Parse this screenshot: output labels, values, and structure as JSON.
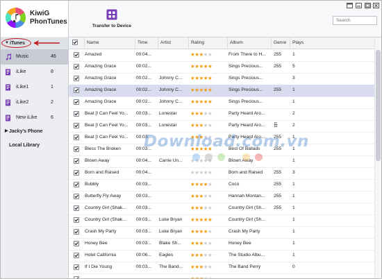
{
  "app": {
    "name_line1": "KiwiG",
    "name_line2": "PhonTunes"
  },
  "sidebar": {
    "itunes_label": "iTunes",
    "items": [
      {
        "label": "Music",
        "count": "46",
        "icon": "music-note-icon",
        "selected": true
      },
      {
        "label": "iLike",
        "count": "8",
        "icon": "playlist-icon"
      },
      {
        "label": "iLike1",
        "count": "1",
        "icon": "playlist-icon"
      },
      {
        "label": "iLike2",
        "count": "2",
        "icon": "playlist-icon"
      },
      {
        "label": "New iLike",
        "count": "6",
        "icon": "playlist-icon"
      }
    ],
    "phone_label": "Jacky's Phone",
    "local_label": "Local Library"
  },
  "toolbar": {
    "transfer_label": "Transfer to Device"
  },
  "search": {
    "placeholder": "Search"
  },
  "columns": {
    "name": "Name",
    "time": "Time",
    "artist": "Artist",
    "rating": "Rating",
    "album": "Album",
    "genre": "Genre",
    "plays": "Plays"
  },
  "rows": [
    {
      "name": "Amazed",
      "time": "00:04...",
      "artist": "",
      "rating": 3,
      "album": "From There to H...",
      "genre": "255",
      "plays": "1"
    },
    {
      "name": "Amazing Grace",
      "time": "00:02...",
      "artist": "",
      "rating": 5,
      "album": "Sings Precious...",
      "genre": "255",
      "plays": "5"
    },
    {
      "name": "Amazing Grace",
      "time": "00:02...",
      "artist": "Johnny C...",
      "rating": 5,
      "album": "Sings Precious...",
      "genre": "",
      "plays": "3"
    },
    {
      "name": "Amazing Grace",
      "time": "00:02...",
      "artist": "Johnny C...",
      "rating": 5,
      "album": "Sings Precious...",
      "genre": "255",
      "plays": "1",
      "selected": true
    },
    {
      "name": "Amazing Grace",
      "time": "00:02...",
      "artist": "Johnny C...",
      "rating": 5,
      "album": "Sings Precious...",
      "genre": "",
      "plays": "1"
    },
    {
      "name": "Beat [I Can Feel Yo...",
      "time": "00:03...",
      "artist": "Lonestar",
      "rating": 3,
      "album": "Party Heard Aro...",
      "genre": "",
      "plays": "2"
    },
    {
      "name": "Beat [I Can Feel Yo...",
      "time": "00:03...",
      "artist": "Lonestar",
      "rating": 3,
      "album": "Party Heard Aro...",
      "genre": "듬",
      "plays": "2"
    },
    {
      "name": "Beat [I Can Feel Yo...",
      "time": "00:03...",
      "artist": "",
      "rating": 3,
      "album": "Party Heard Aro...",
      "genre": "255",
      "plays": "1"
    },
    {
      "name": "Bless The Broken",
      "time": "00:03...",
      "artist": "",
      "rating": 5,
      "album": "Best Of Ballads",
      "genre": "255",
      "plays": "1"
    },
    {
      "name": "Blown Away",
      "time": "00:04...",
      "artist": "Carrie Un...",
      "rating": 0,
      "album": "Blown Away",
      "genre": "",
      "plays": "1"
    },
    {
      "name": "Born and Raised",
      "time": "00:04...",
      "artist": "",
      "rating": 0,
      "album": "Born and Raised",
      "genre": "255",
      "plays": "3"
    },
    {
      "name": "Bubbly",
      "time": "00:03...",
      "artist": "",
      "rating": 4,
      "album": "Coco",
      "genre": "255",
      "plays": "1"
    },
    {
      "name": "Butterfly Fly Away",
      "time": "00:03...",
      "artist": "",
      "rating": 3,
      "album": "Hannah Montan...",
      "genre": "255",
      "plays": "1"
    },
    {
      "name": "Country Girl (Shak...",
      "time": "00:03...",
      "artist": "",
      "rating": 3,
      "album": "Country Girl (Sh...",
      "genre": "255",
      "plays": "1"
    },
    {
      "name": "Country Girl (Shak...",
      "time": "00:03...",
      "artist": "Luke Bryan",
      "rating": 5,
      "album": "Country Girl (Sh...",
      "genre": "",
      "plays": "1"
    },
    {
      "name": "Crash My Party",
      "time": "00:03...",
      "artist": "Luke Bryan",
      "rating": 4,
      "album": "Crash My Party",
      "genre": "",
      "plays": "1"
    },
    {
      "name": "Honey Bee",
      "time": "00:03...",
      "artist": "Blake Sh...",
      "rating": 3,
      "album": "Honey Bee",
      "genre": "",
      "plays": "1"
    },
    {
      "name": "Hotel California",
      "time": "00:06...",
      "artist": "Eagles",
      "rating": 3,
      "album": "The Studio Albu...",
      "genre": "",
      "plays": "1"
    },
    {
      "name": "If I Die Young",
      "time": "00:03...",
      "artist": "The Band...",
      "rating": 3,
      "album": "The Band Perry",
      "genre": "",
      "plays": "0"
    },
    {
      "name": "",
      "time": "",
      "artist": "",
      "rating": 3,
      "album": "",
      "genre": "",
      "plays": ""
    }
  ],
  "watermark": {
    "text": "Download.com.vn"
  },
  "colors": {
    "selected_row": "#d9dbee",
    "star": "#f39c12",
    "annotation": "#c0181f"
  }
}
